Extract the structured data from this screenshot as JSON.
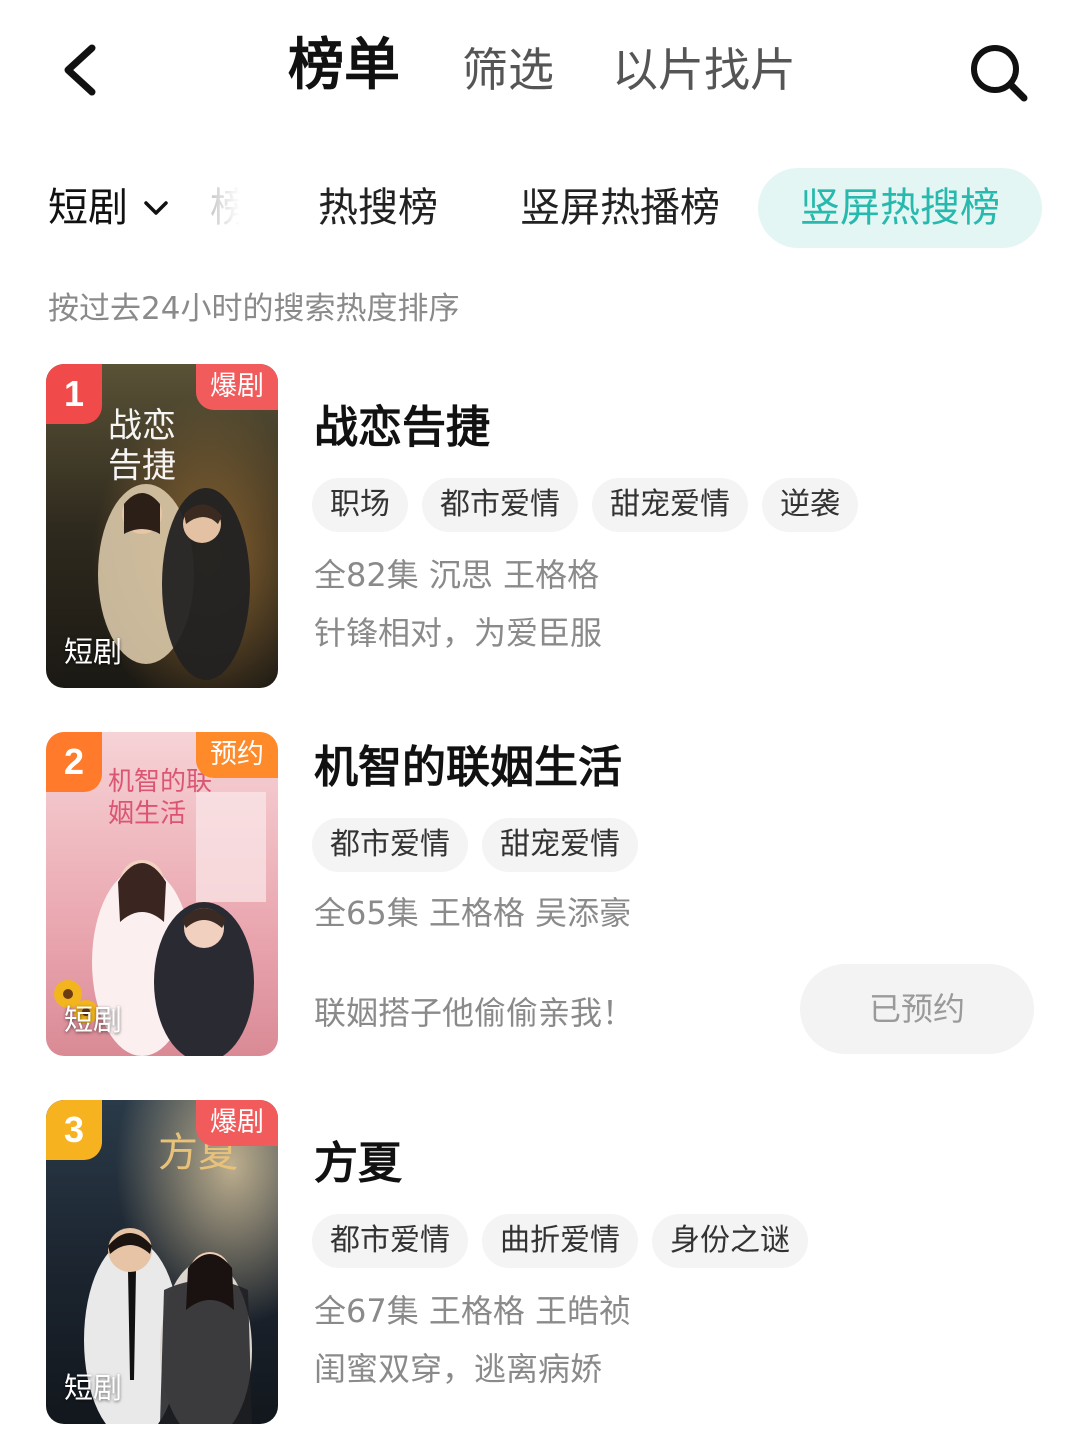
{
  "header": {
    "tabs": [
      "榜单",
      "筛选",
      "以片找片"
    ],
    "active_tab_index": 0
  },
  "category": {
    "selected": "短剧",
    "faded_tab_fragment": "榜",
    "rank_tabs": [
      "热搜榜",
      "竖屏热播榜",
      "竖屏热搜榜"
    ],
    "active_rank_tab_index": 2
  },
  "subtitle": "按过去24小时的搜索热度排序",
  "items": [
    {
      "rank": "1",
      "rank_color": "#f04a4a",
      "badge": "爆剧",
      "badge_color": "#f25b5b",
      "type_label": "短剧",
      "poster_caption": "战恋告捷",
      "title": "战恋告捷",
      "tags": [
        "职场",
        "都市爱情",
        "甜宠爱情",
        "逆袭"
      ],
      "meta": "全82集 沉思 王格格",
      "desc": "针锋相对，为爱臣服"
    },
    {
      "rank": "2",
      "rank_color": "#ff7a2a",
      "badge": "预约",
      "badge_color": "#ff8a2a",
      "type_label": "短剧",
      "poster_caption": "机智的联姻生活",
      "title": "机智的联姻生活",
      "tags": [
        "都市爱情",
        "甜宠爱情"
      ],
      "meta": "全65集 王格格 吴添豪",
      "desc": "联姻搭子他偷偷亲我！",
      "reserve_label": "已预约"
    },
    {
      "rank": "3",
      "rank_color": "#f7b21f",
      "badge": "爆剧",
      "badge_color": "#f25b5b",
      "type_label": "短剧",
      "poster_caption": "方夏",
      "title": "方夏",
      "tags": [
        "都市爱情",
        "曲折爱情",
        "身份之谜"
      ],
      "meta": "全67集 王格格 王皓祯",
      "desc": "闺蜜双穿，逃离病娇"
    }
  ]
}
